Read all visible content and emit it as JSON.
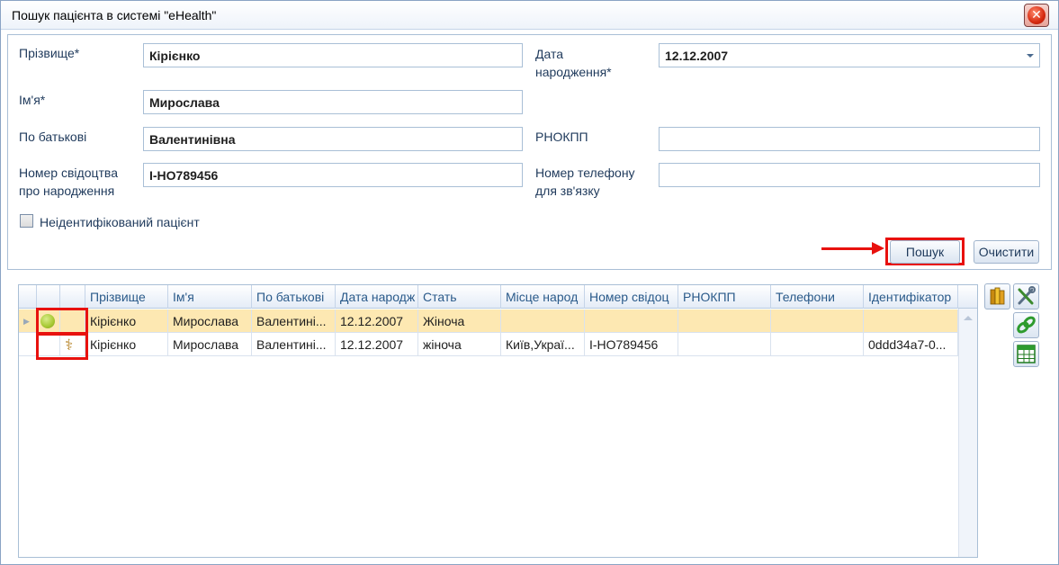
{
  "window": {
    "title": "Пошук пацієнта в системі \"eHealth\""
  },
  "form": {
    "surname": {
      "label": "Прізвище*",
      "value": "Кірієнко"
    },
    "first_name": {
      "label": "Ім'я*",
      "value": "Мирослава"
    },
    "patronymic": {
      "label": "По батькові",
      "value": "Валентинівна"
    },
    "birth_cert": {
      "label_line1": "Номер свідоцтва",
      "label_line2": "про народження",
      "value": "І-НО789456"
    },
    "birth_date": {
      "label_line1": "Дата",
      "label_line2": "народження*",
      "value": "12.12.2007"
    },
    "rnokpp": {
      "label": "РНОКПП",
      "value": ""
    },
    "phone": {
      "label_line1": "Номер телефону",
      "label_line2": "для зв'язку",
      "value": ""
    },
    "unidentified_label": "Неідентифікований пацієнт"
  },
  "buttons": {
    "search": "Пошук",
    "clear": "Очистити"
  },
  "grid": {
    "columns": [
      "Прізвище",
      "Ім'я",
      "По батькові",
      "Дата народж",
      "Стать",
      "Місце народ",
      "Номер свідоц",
      "РНОКПП",
      "Телефони",
      "Ідентифікатор"
    ],
    "rows": [
      {
        "status_icon": "green-dot-icon",
        "type_icon": "",
        "surname": "Кірієнко",
        "first_name": "Мирослава",
        "patronymic": "Валентині...",
        "birth_date": "12.12.2007",
        "sex": "Жіноча",
        "birth_place": "",
        "cert": "",
        "rnokpp": "",
        "phones": "",
        "id": ""
      },
      {
        "status_icon": "",
        "type_icon": "caduceus-icon",
        "surname": "Кірієнко",
        "first_name": "Мирослава",
        "patronymic": "Валентині...",
        "birth_date": "12.12.2007",
        "sex": "жіноча",
        "birth_place": "Київ,Украї...",
        "cert": "І-НО789456",
        "rnokpp": "",
        "phones": "",
        "id": "0ddd34a7-0..."
      }
    ]
  },
  "colors": {
    "highlight": "#e8110e",
    "selected_row": "#fde8b2",
    "status_green": "#a6c832"
  }
}
